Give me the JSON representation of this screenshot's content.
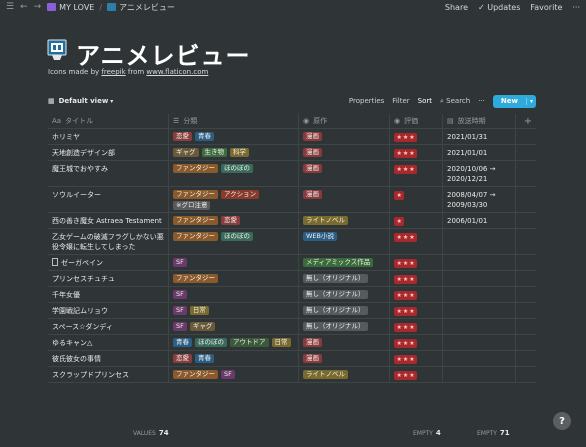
{
  "topbar": {
    "workspace": "MY LOVE",
    "page": "アニメレビュー",
    "share": "Share",
    "updates": "Updates",
    "favorite": "Favorite"
  },
  "header": {
    "title": "アニメレビュー",
    "credit_prefix": "Icons made by ",
    "credit_author": "freepik",
    "credit_mid": " from ",
    "credit_site": "www.flaticon.com"
  },
  "viewbar": {
    "view": "Default view",
    "properties": "Properties",
    "filter": "Filter",
    "sort": "Sort",
    "search": "Search",
    "more": "···",
    "new": "New"
  },
  "columns": {
    "title": "タイトル",
    "category": "分類",
    "source": "原作",
    "rating": "評価",
    "period": "放送時期",
    "add": "+"
  },
  "colors": {
    "恋愛": "#8a3e3c",
    "青春": "#2c5d83",
    "ギャグ": "#6b5a3a",
    "生き物": "#3f6b3f",
    "科学": "#7a6a2d",
    "ファンタジー": "#8a5a2b",
    "ほのぼの": "#3a6b5a",
    "アクション": "#8a3a2b",
    "※グロ注意": "#5a5a5a",
    "SF": "#6a3a6a",
    "日常": "#7a6a2d",
    "アウトドア": "#3a5a3a",
    "漫画": "#8a3a3c",
    "ライトノベル": "#7a6a2d",
    "WEB小説": "#2c5d83",
    "メディアミックス作品": "#3a6b3a",
    "無し（オリジナル）": "#555a5d"
  },
  "rows": [
    {
      "title": "ホリミヤ",
      "category": [
        "恋愛",
        "青春"
      ],
      "source": [
        "漫画"
      ],
      "stars": 3,
      "period": [
        "2021/01/31"
      ]
    },
    {
      "title": "天地創造デザイン部",
      "category": [
        "ギャグ",
        "生き物",
        "科学"
      ],
      "source": [
        "漫画"
      ],
      "stars": 3,
      "period": [
        "2021/01/01"
      ]
    },
    {
      "title": "魔王城でおやすみ",
      "category": [
        "ファンタジー",
        "ほのぼの"
      ],
      "source": [
        "漫画"
      ],
      "stars": 3,
      "period": [
        "2020/10/06 →",
        "2020/12/21"
      ]
    },
    {
      "title": "ソウルイーター",
      "category": [
        "ファンタジー",
        "アクション",
        "※グロ注意"
      ],
      "source": [
        "漫画"
      ],
      "stars": 1,
      "period": [
        "2008/04/07 →",
        "2009/03/30"
      ]
    },
    {
      "title": "西の善き魔女 Astraea Testament",
      "category": [
        "ファンタジー",
        "恋愛"
      ],
      "source": [
        "ライトノベル"
      ],
      "stars": 1,
      "period": [
        "2006/01/01"
      ]
    },
    {
      "title": "乙女ゲームの破滅フラグしかない悪役令嬢に転生してしまった",
      "category": [
        "ファンタジー",
        "ほのぼの"
      ],
      "source": [
        "WEB小説"
      ],
      "stars": 3,
      "period": []
    },
    {
      "title": "ゼーガペイン",
      "doc": true,
      "category": [
        "SF"
      ],
      "source": [
        "メディアミックス作品"
      ],
      "stars": 3,
      "period": []
    },
    {
      "title": "プリンセスチュチュ",
      "category": [
        "ファンタジー"
      ],
      "source": [
        "無し（オリジナル）"
      ],
      "stars": 3,
      "period": []
    },
    {
      "title": "千年女優",
      "category": [
        "SF"
      ],
      "source": [
        "無し（オリジナル）"
      ],
      "stars": 3,
      "period": []
    },
    {
      "title": "学園戦記ムリョウ",
      "category": [
        "SF",
        "日常"
      ],
      "source": [
        "無し（オリジナル）"
      ],
      "stars": 3,
      "period": []
    },
    {
      "title": "スペース☆ダンディ",
      "category": [
        "SF",
        "ギャグ"
      ],
      "source": [
        "無し（オリジナル）"
      ],
      "stars": 3,
      "period": []
    },
    {
      "title": "ゆるキャン△",
      "category": [
        "青春",
        "ほのぼの",
        "アウトドア",
        "日常"
      ],
      "source": [
        "漫画"
      ],
      "stars": 3,
      "period": []
    },
    {
      "title": "彼氏彼女の事情",
      "category": [
        "恋愛",
        "青春"
      ],
      "source": [
        "漫画"
      ],
      "stars": 3,
      "period": []
    },
    {
      "title": "スクラップドプリンセス",
      "category": [
        "ファンタジー",
        "SF"
      ],
      "source": [
        "ライトノベル"
      ],
      "stars": 3,
      "period": []
    }
  ],
  "footer": {
    "values_label": "VALUES",
    "values_count": "74",
    "empty_label": "EMPTY",
    "empty1": "4",
    "empty2": "71"
  },
  "help": "?"
}
